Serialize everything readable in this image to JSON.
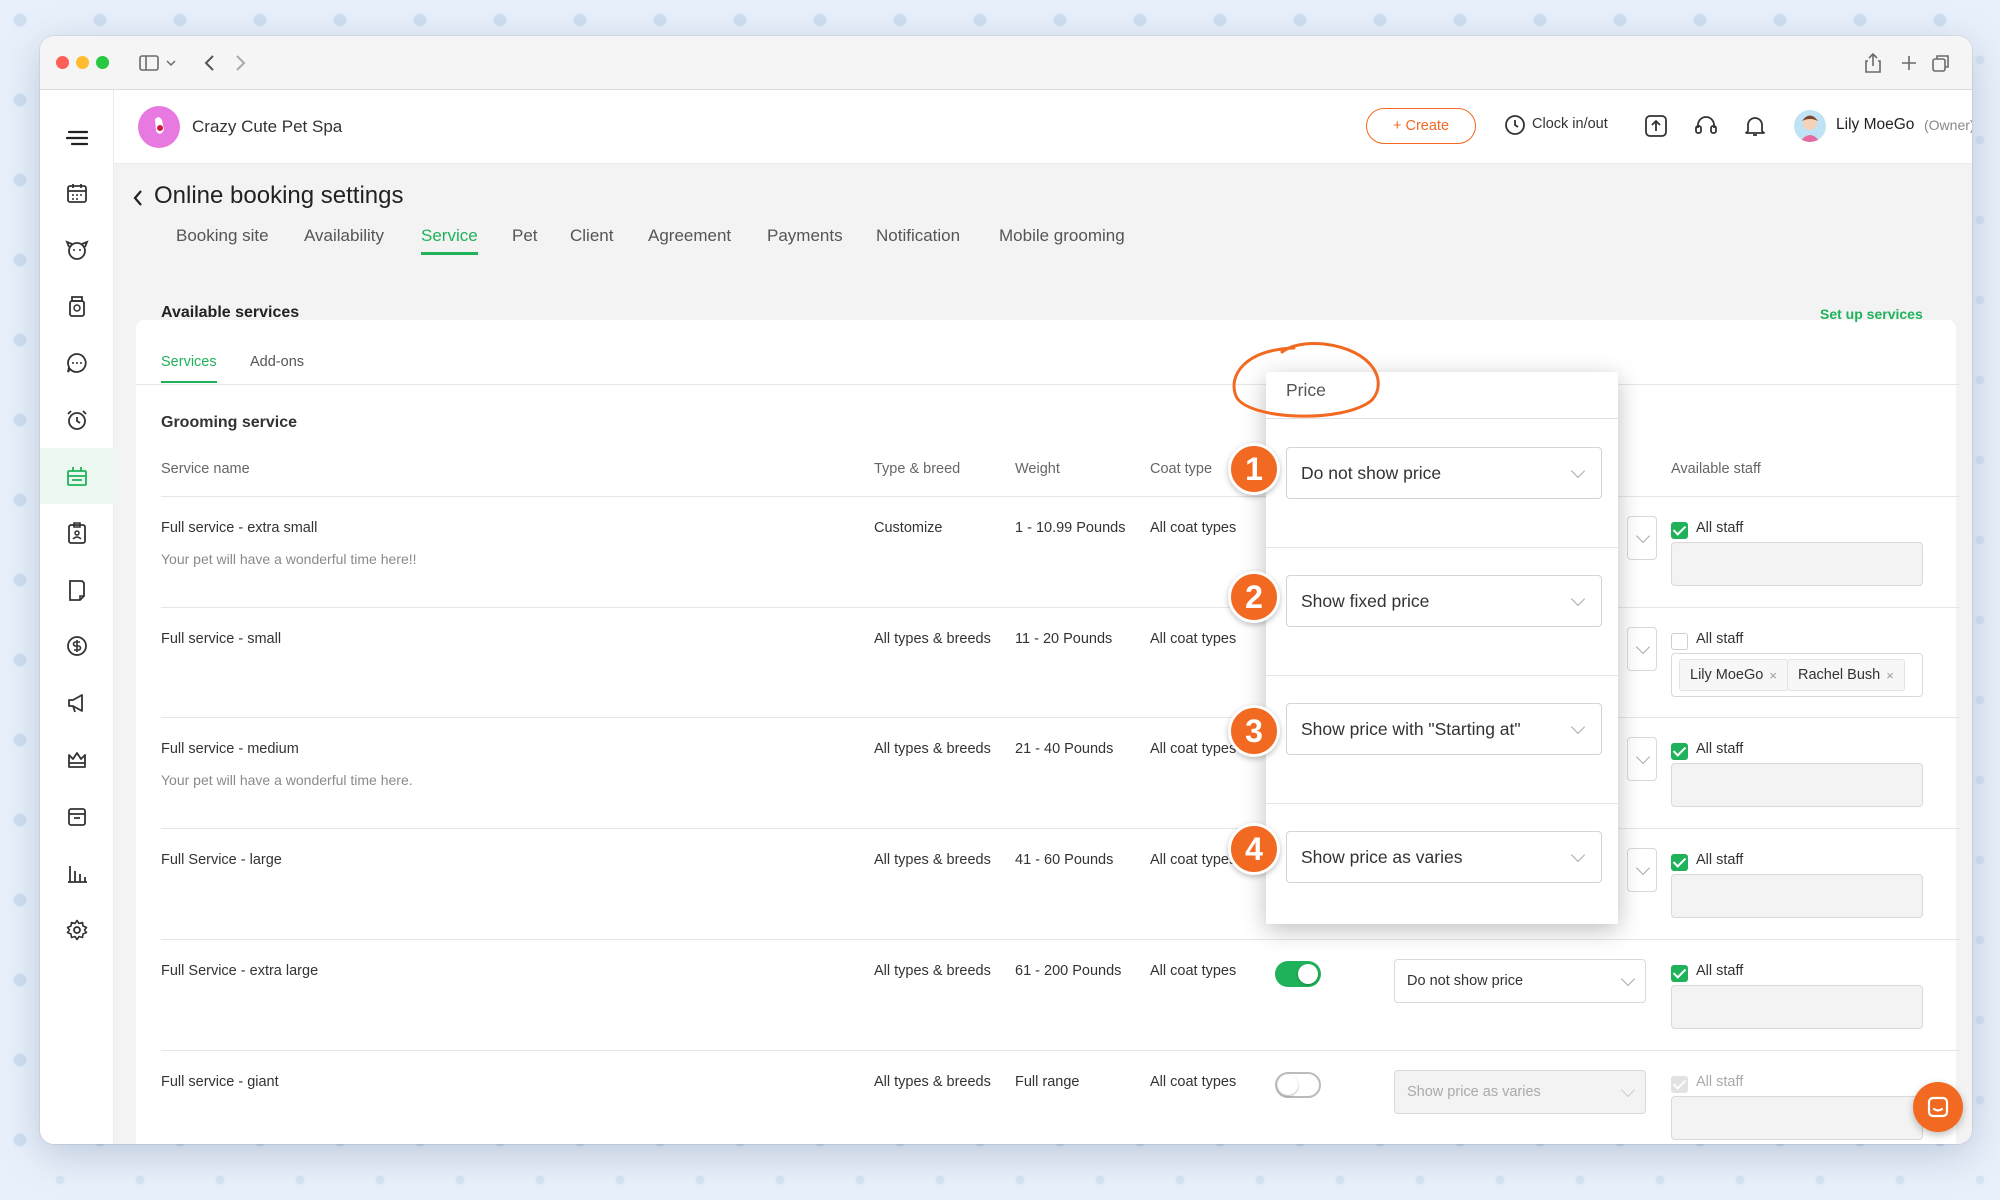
{
  "browser": {
    "icons": [
      "sidebar-toggle-icon",
      "chevron-down-icon",
      "back-arrow-icon",
      "forward-arrow-icon",
      "share-icon",
      "new-tab-icon",
      "tabs-overview-icon"
    ]
  },
  "sidebar": {
    "items": [
      "menu-icon",
      "calendar-icon",
      "pet-icon",
      "store-icon",
      "message-icon",
      "reminder-icon",
      "online-booking-icon",
      "clipboard-icon",
      "report-card-icon",
      "payment-icon",
      "marketing-icon",
      "membership-icon",
      "retail-icon",
      "reports-icon",
      "settings-icon"
    ],
    "active": "online-booking-icon"
  },
  "topbar": {
    "business_name": "Crazy Cute Pet Spa",
    "create_label": "+ Create",
    "clock_label": "Clock in/out",
    "user_name": "Lily MoeGo",
    "user_role": "(Owner)"
  },
  "page": {
    "title": "Online booking settings",
    "tabs": [
      "Booking site",
      "Availability",
      "Service",
      "Pet",
      "Client",
      "Agreement",
      "Payments",
      "Notification",
      "Mobile grooming"
    ],
    "active_tab": "Service"
  },
  "card": {
    "title": "Available services",
    "setup_link": "Set up services",
    "subtabs": [
      "Services",
      "Add-ons"
    ],
    "section_title": "Grooming service",
    "headers": {
      "service_name": "Service name",
      "type_breed": "Type & breed",
      "weight": "Weight",
      "coat_type": "Coat type",
      "available_staff": "Available staff"
    },
    "rows": [
      {
        "name": "Full service - extra small",
        "desc": "Your pet will have a wonderful time here!!",
        "type": "Customize",
        "weight": "1 - 10.99 Pounds",
        "coat": "All coat types",
        "staff_label": "All staff"
      },
      {
        "name": "Full service - small",
        "desc": "",
        "type": "All types & breeds",
        "weight": "11 - 20 Pounds",
        "coat": "All coat types",
        "staff_label": "All staff",
        "staff_tags": [
          "Lily MoeGo",
          "Rachel Bush"
        ]
      },
      {
        "name": "Full service - medium",
        "desc": "Your pet will have a wonderful time here.",
        "type": "All types & breeds",
        "weight": "21 - 40 Pounds",
        "coat": "All coat types",
        "staff_label": "All staff"
      },
      {
        "name": "Full Service - large",
        "desc": "",
        "type": "All types & breeds",
        "weight": "41 - 60 Pounds",
        "coat": "All coat types",
        "staff_label": "All staff"
      },
      {
        "name": "Full Service - extra large",
        "desc": "",
        "type": "All types & breeds",
        "weight": "61 - 200 Pounds",
        "coat": "All coat types",
        "price": "Do not show price",
        "staff_label": "All staff",
        "enabled": true
      },
      {
        "name": "Full service - giant",
        "desc": "",
        "type": "All types & breeds",
        "weight": "Full range",
        "coat": "All coat types",
        "price": "Show price as varies",
        "staff_label": "All staff",
        "enabled": false
      }
    ]
  },
  "popup": {
    "title": "Price",
    "options": [
      {
        "num": "1",
        "label": "Do not show price"
      },
      {
        "num": "2",
        "label": "Show fixed price"
      },
      {
        "num": "3",
        "label": "Show price with \"Starting at\""
      },
      {
        "num": "4",
        "label": "Show price as varies"
      }
    ]
  },
  "colors": {
    "accent_green": "#1fb25a",
    "accent_orange": "#f26a21"
  }
}
